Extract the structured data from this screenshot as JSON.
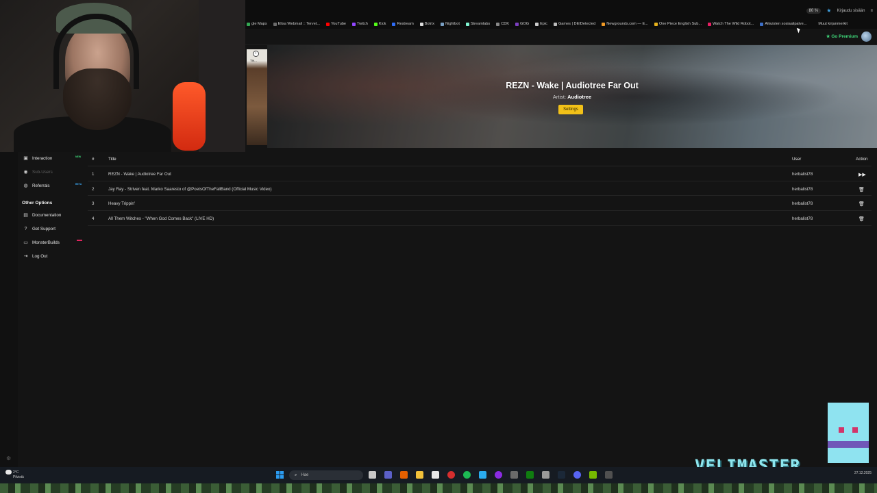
{
  "browser": {
    "zoom": "80 %",
    "signin_label": "Kirjaudu sisään",
    "bookmarks": [
      {
        "label": "gle Maps",
        "color": "#34a853"
      },
      {
        "label": "Elisa Webmail :: Tervet...",
        "color": "#6b6b6b"
      },
      {
        "label": "YouTube",
        "color": "#ff0000"
      },
      {
        "label": "Twitch",
        "color": "#9146ff"
      },
      {
        "label": "Kick",
        "color": "#53fc18"
      },
      {
        "label": "Restream",
        "color": "#2f6cf6"
      },
      {
        "label": "Botrix",
        "color": "#dddddd"
      },
      {
        "label": "Nightbot",
        "color": "#7aa0c4"
      },
      {
        "label": "Streamlabs",
        "color": "#80f5d2"
      },
      {
        "label": "CDK",
        "color": "#888888"
      },
      {
        "label": "GOG",
        "color": "#7b3fbf"
      },
      {
        "label": "Epic",
        "color": "#cccccc"
      },
      {
        "label": "Games | DEIDetected",
        "color": "#bbbbbb"
      },
      {
        "label": "Newgrounds.com — E...",
        "color": "#f29a25"
      },
      {
        "label": "One Piece English Sub...",
        "color": "#e6b11b"
      },
      {
        "label": "Watch The Wild Robot...",
        "color": "#e91e63"
      },
      {
        "label": "Aikuisten sosiaalipalve...",
        "color": "#3d6fc7"
      }
    ],
    "other_bookmarks": "Muut kirjanmerkit"
  },
  "header": {
    "premium_label": "Go Premium"
  },
  "mini_thumb": {
    "caption": "Tie..."
  },
  "now_playing": {
    "title": "REZN - Wake | Audiotree Far Out",
    "artist_label": "Artist:",
    "artist": "Audiotree",
    "settings_label": "Settings"
  },
  "sidebar": {
    "items": [
      {
        "label": "Interaction",
        "icon": "chat-icon",
        "tag": "NEW",
        "tag_color": "#3fd97a"
      },
      {
        "label": "Sub-Users",
        "icon": "users-icon",
        "disabled": true
      },
      {
        "label": "Referrals",
        "icon": "referral-icon",
        "tag": "BETA",
        "tag_color": "#39a0e8"
      }
    ],
    "other_heading": "Other Options",
    "other_items": [
      {
        "label": "Documentation",
        "icon": "document-icon"
      },
      {
        "label": "Get Support",
        "icon": "help-icon"
      },
      {
        "label": "MonsterBuilds",
        "icon": "monitor-icon",
        "tag_color": "#e0245e"
      },
      {
        "label": "Log Out",
        "icon": "logout-icon"
      }
    ]
  },
  "queue": {
    "columns": [
      "#",
      "Title",
      "User",
      "Action"
    ],
    "rows": [
      {
        "num": "1",
        "title": "REZN - Wake | Audiotree Far Out",
        "user": "herbalist78",
        "action": "play-icon"
      },
      {
        "num": "2",
        "title": "Jay Ray - Striven feat. Marko Saaresto of @PoetsOfTheFallBand (Official Music Video)",
        "user": "herbalist78",
        "action": "trash-icon"
      },
      {
        "num": "3",
        "title": "Heavy Trippin'",
        "user": "herbalist78",
        "action": "trash-icon"
      },
      {
        "num": "4",
        "title": "All Them Witches - \"When God Comes Back\" (LIVE HD)",
        "user": "herbalist78",
        "action": "trash-icon"
      }
    ]
  },
  "overlay": {
    "brand": "VELIMASTER"
  },
  "taskbar": {
    "temperature": "2°C",
    "weather": "Pilvistä",
    "search_placeholder": "Hae",
    "date": "27.12.2025"
  }
}
